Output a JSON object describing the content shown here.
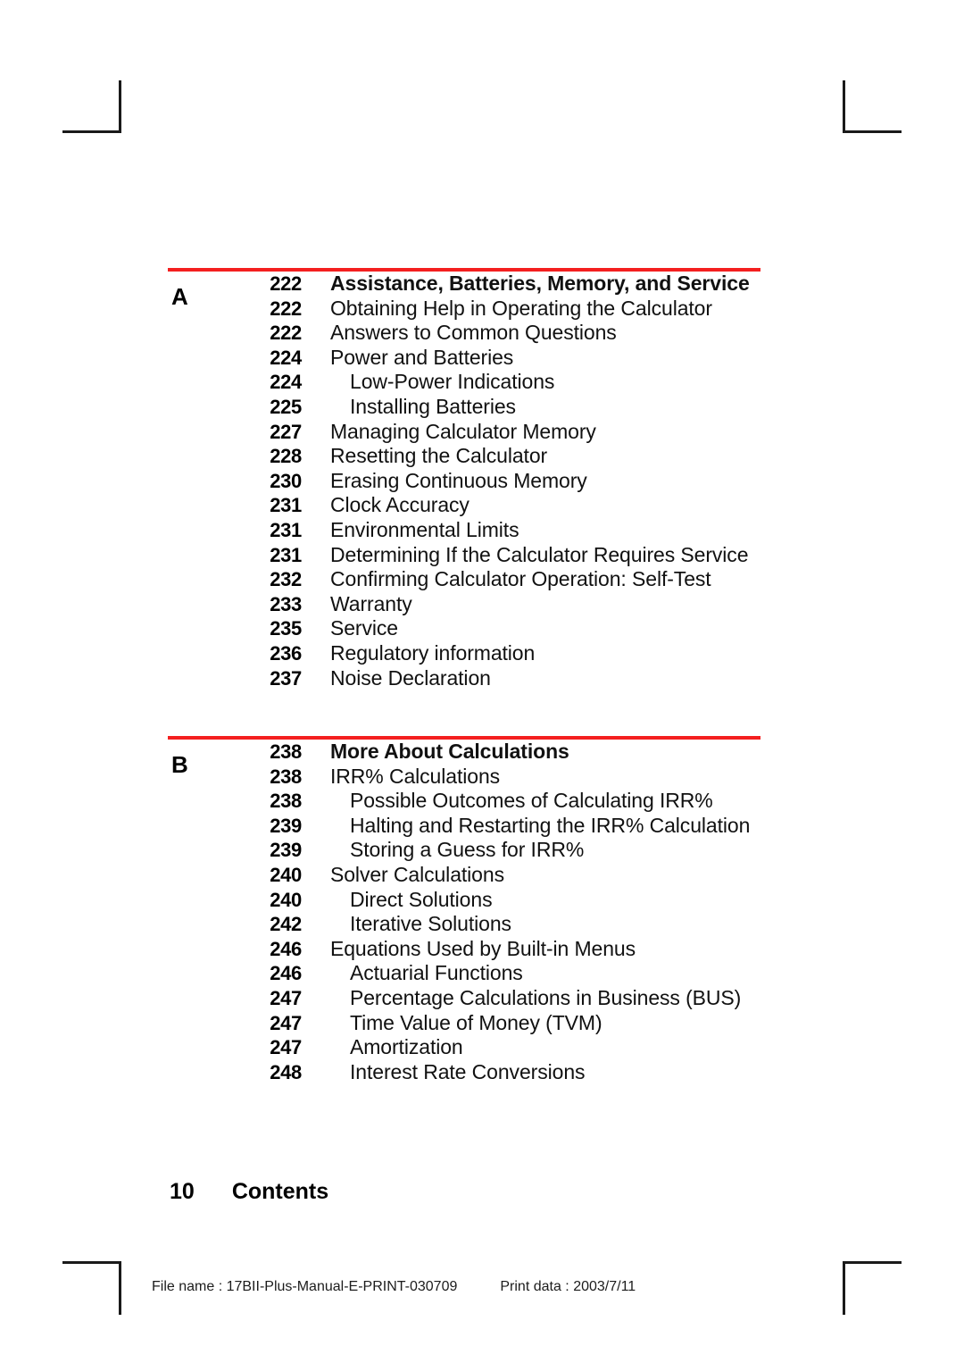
{
  "document": {
    "folio_number": "10",
    "folio_label": "Contents"
  },
  "production": {
    "file_label": "File name : 17BII-Plus-Manual-E-PRINT-030709",
    "date_label": "Print data : 2003/7/11"
  },
  "colors": {
    "rule_red": "#f41f1f",
    "text_black": "#111111"
  },
  "sections": [
    {
      "letter": "A",
      "entries": [
        {
          "page": "222",
          "title": "Assistance, Batteries, Memory, and Service",
          "level": 0
        },
        {
          "page": "222",
          "title": "Obtaining Help in Operating the Calculator",
          "level": 1
        },
        {
          "page": "222",
          "title": "Answers to Common Questions",
          "level": 1
        },
        {
          "page": "224",
          "title": "Power and Batteries",
          "level": 1
        },
        {
          "page": "224",
          "title": "Low-Power Indications",
          "level": 2
        },
        {
          "page": "225",
          "title": "Installing Batteries",
          "level": 2
        },
        {
          "page": "227",
          "title": "Managing Calculator Memory",
          "level": 1
        },
        {
          "page": "228",
          "title": "Resetting the Calculator",
          "level": 1
        },
        {
          "page": "230",
          "title": "Erasing Continuous Memory",
          "level": 1
        },
        {
          "page": "231",
          "title": "Clock Accuracy",
          "level": 1
        },
        {
          "page": "231",
          "title": "Environmental Limits",
          "level": 1
        },
        {
          "page": "231",
          "title": "Determining If the Calculator Requires Service",
          "level": 1
        },
        {
          "page": "232",
          "title": "Confirming Calculator Operation: Self-Test",
          "level": 1
        },
        {
          "page": "233",
          "title": "Warranty",
          "level": 1
        },
        {
          "page": "235",
          "title": "Service",
          "level": 1
        },
        {
          "page": "236",
          "title": "Regulatory information",
          "level": 1
        },
        {
          "page": "237",
          "title": "Noise Declaration",
          "level": 1
        }
      ]
    },
    {
      "letter": "B",
      "entries": [
        {
          "page": "238",
          "title": "More About Calculations",
          "level": 0
        },
        {
          "page": "238",
          "title": "IRR% Calculations",
          "level": 1
        },
        {
          "page": "238",
          "title": "Possible Outcomes of Calculating IRR%",
          "level": 2
        },
        {
          "page": "239",
          "title": "Halting and Restarting the IRR% Calculation",
          "level": 2
        },
        {
          "page": "239",
          "title": "Storing a Guess for IRR%",
          "level": 2
        },
        {
          "page": "240",
          "title": "Solver Calculations",
          "level": 1
        },
        {
          "page": "240",
          "title": "Direct Solutions",
          "level": 2
        },
        {
          "page": "242",
          "title": "Iterative Solutions",
          "level": 2
        },
        {
          "page": "246",
          "title": "Equations Used by Built-in Menus",
          "level": 1
        },
        {
          "page": "246",
          "title": "Actuarial Functions",
          "level": 2
        },
        {
          "page": "247",
          "title": "Percentage Calculations in Business (BUS)",
          "level": 2
        },
        {
          "page": "247",
          "title": "Time Value of Money (TVM)",
          "level": 2
        },
        {
          "page": "247",
          "title": "Amortization",
          "level": 2
        },
        {
          "page": "248",
          "title": "Interest Rate Conversions",
          "level": 2
        }
      ]
    }
  ]
}
